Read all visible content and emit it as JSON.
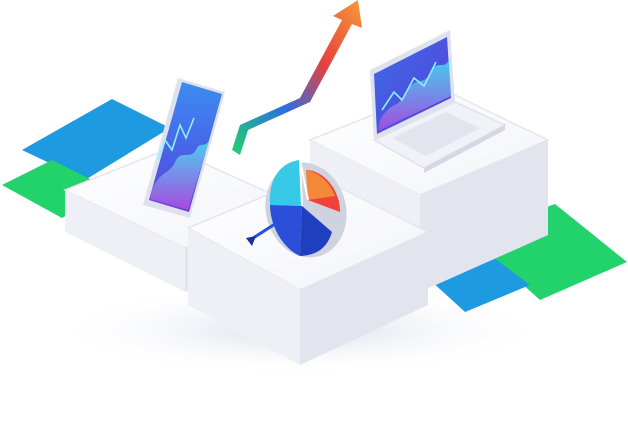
{
  "illustration": {
    "subject": [
      "smartphone",
      "pie-chart-target",
      "growth-arrow",
      "laptop"
    ],
    "colors": {
      "green": "#22d36b",
      "blue": "#1d9ae0",
      "deep_blue": "#2b4fd8",
      "purple": "#5b3bd6",
      "red": "#f0423a",
      "orange": "#f59a3a",
      "cyan": "#36c9e8",
      "white": "#ffffff",
      "platform_side": "#e7e9f1"
    }
  }
}
